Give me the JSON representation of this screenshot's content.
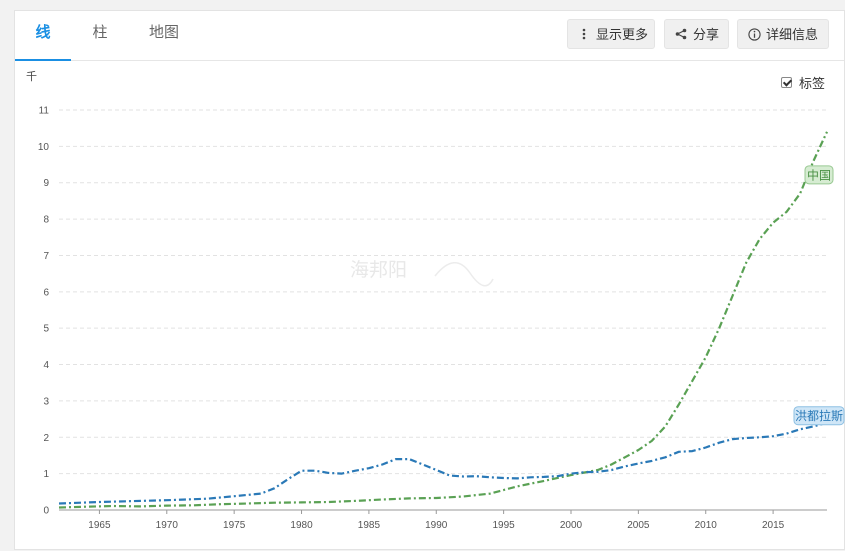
{
  "tabs": [
    {
      "label": "线",
      "active": true
    },
    {
      "label": "柱",
      "active": false
    },
    {
      "label": "地图",
      "active": false
    }
  ],
  "toolbar": {
    "more_label": "显示更多",
    "share_label": "分享",
    "details_label": "详细信息"
  },
  "label_toggle": {
    "label": "标签",
    "checked": true
  },
  "watermark": "海邦阳",
  "chart_data": {
    "type": "line",
    "unit_label": "千",
    "xlabel": "",
    "ylabel": "",
    "xlim": [
      1962,
      2019
    ],
    "ylim": [
      0,
      11
    ],
    "xticks": [
      1965,
      1970,
      1975,
      1980,
      1985,
      1990,
      1995,
      2000,
      2005,
      2010,
      2015
    ],
    "yticks": [
      0,
      1,
      2,
      3,
      4,
      5,
      6,
      7,
      8,
      9,
      10,
      11
    ],
    "grid": true,
    "series": [
      {
        "name": "中国",
        "color": "#5aa154",
        "x": [
          1962,
          1964,
          1966,
          1968,
          1970,
          1972,
          1974,
          1976,
          1978,
          1980,
          1982,
          1984,
          1986,
          1988,
          1990,
          1992,
          1994,
          1996,
          1998,
          2000,
          2001,
          2002,
          2003,
          2004,
          2005,
          2006,
          2007,
          2008,
          2009,
          2010,
          2011,
          2012,
          2013,
          2014,
          2015,
          2016,
          2017,
          2018,
          2019
        ],
        "values": [
          0.07,
          0.09,
          0.11,
          0.1,
          0.12,
          0.13,
          0.16,
          0.18,
          0.2,
          0.21,
          0.22,
          0.25,
          0.29,
          0.32,
          0.33,
          0.37,
          0.45,
          0.65,
          0.8,
          0.96,
          1.03,
          1.1,
          1.25,
          1.45,
          1.65,
          1.9,
          2.3,
          2.9,
          3.55,
          4.2,
          5.0,
          5.9,
          6.8,
          7.45,
          7.9,
          8.2,
          8.7,
          9.6,
          10.4
        ]
      },
      {
        "name": "洪都拉斯",
        "color": "#2a79b7",
        "x": [
          1962,
          1965,
          1970,
          1973,
          1975,
          1977,
          1978,
          1979,
          1980,
          1981,
          1982,
          1983,
          1984,
          1985,
          1986,
          1987,
          1988,
          1989,
          1990,
          1991,
          1992,
          1993,
          1994,
          1995,
          1996,
          1997,
          1998,
          1999,
          2000,
          2001,
          2002,
          2003,
          2004,
          2005,
          2006,
          2007,
          2008,
          2009,
          2010,
          2011,
          2012,
          2013,
          2014,
          2015,
          2016,
          2017,
          2018,
          2019
        ],
        "values": [
          0.18,
          0.22,
          0.27,
          0.31,
          0.38,
          0.45,
          0.6,
          0.85,
          1.08,
          1.08,
          1.02,
          1.0,
          1.08,
          1.15,
          1.25,
          1.4,
          1.4,
          1.25,
          1.1,
          0.95,
          0.92,
          0.93,
          0.9,
          0.88,
          0.87,
          0.9,
          0.91,
          0.93,
          1.0,
          1.04,
          1.05,
          1.1,
          1.2,
          1.28,
          1.35,
          1.45,
          1.6,
          1.62,
          1.72,
          1.85,
          1.95,
          1.98,
          2.0,
          2.03,
          2.1,
          2.22,
          2.3,
          2.4
        ]
      }
    ]
  }
}
